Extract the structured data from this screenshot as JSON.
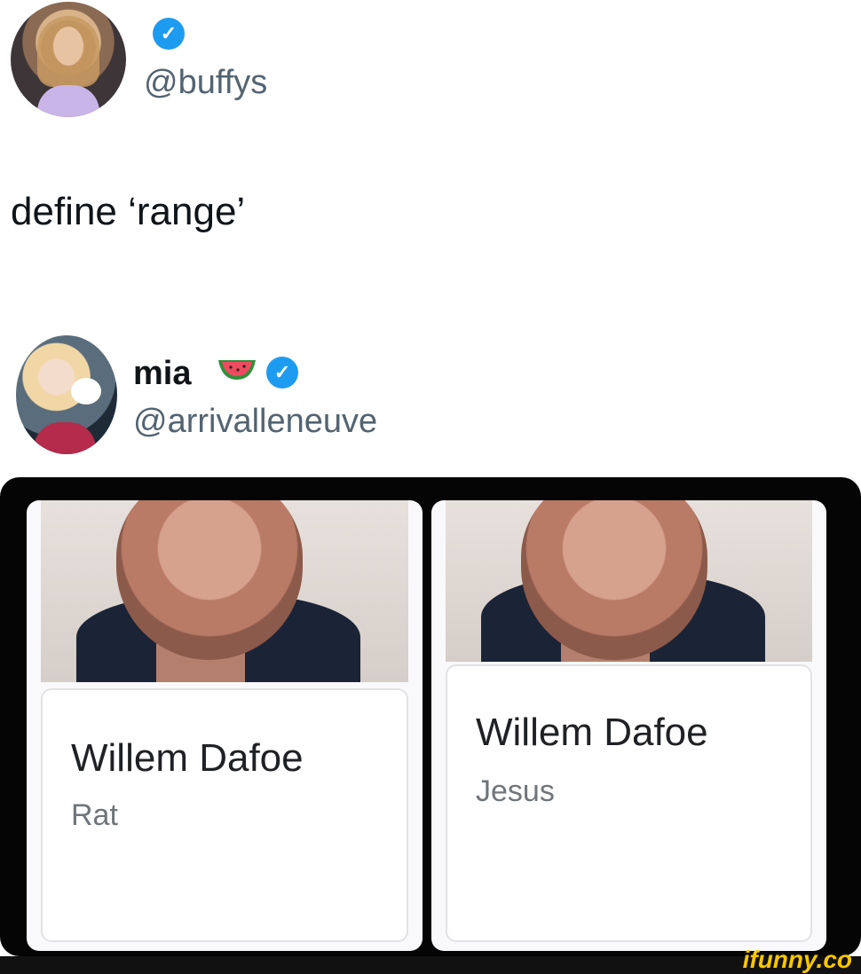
{
  "tweet1": {
    "handle": "@buffys",
    "text": "define ‘range’",
    "verified_icon": "verified-badge-icon"
  },
  "tweet2": {
    "name": "mia",
    "emoji_icon": "watermelon-icon",
    "handle": "@arrivalleneuve",
    "verified_icon": "verified-badge-icon"
  },
  "cards": [
    {
      "name": "Willem Dafoe",
      "role": "Rat"
    },
    {
      "name": "Willem Dafoe",
      "role": "Jesus"
    }
  ],
  "watermark": "ifunny.co",
  "colors": {
    "verified": "#1d9bf0",
    "handle": "#536471",
    "watermark": "#f7c600"
  }
}
